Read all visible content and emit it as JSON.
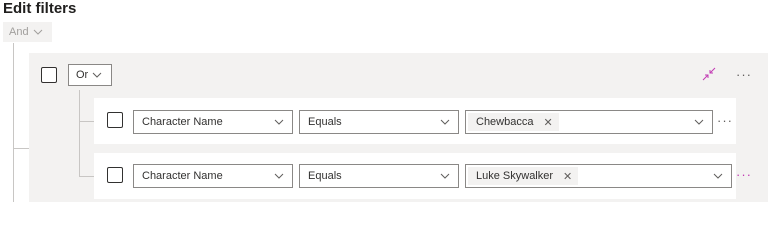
{
  "title": "Edit filters",
  "root": {
    "operator": "And"
  },
  "group": {
    "operator": "Or",
    "more_label": "···",
    "rows": [
      {
        "field": "Character Name",
        "condition": "Equals",
        "value": "Chewbacca",
        "remove": "✕",
        "more_label": "···"
      },
      {
        "field": "Character Name",
        "condition": "Equals",
        "value": "Luke Skywalker",
        "remove": "✕",
        "more_label": "···"
      }
    ]
  },
  "colors": {
    "group_bg": "#f3f2f1",
    "border": "#8a8886",
    "text": "#323130",
    "accent": "#c239b3"
  }
}
